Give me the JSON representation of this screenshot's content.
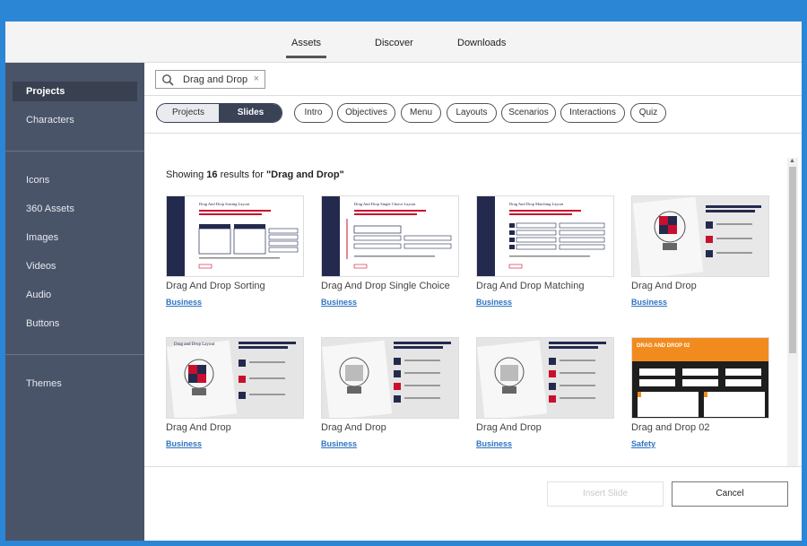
{
  "top_tabs": [
    "Assets",
    "Discover",
    "Downloads"
  ],
  "sidebar": {
    "items": [
      "Projects",
      "Characters",
      "Icons",
      "360 Assets",
      "Images",
      "Videos",
      "Audio",
      "Buttons",
      "Themes"
    ],
    "active": "Projects"
  },
  "search": {
    "query": "Drag and Drop",
    "clear": "×"
  },
  "toggle": {
    "projects": "Projects",
    "slides": "Slides"
  },
  "filters": [
    "Intro",
    "Objectives",
    "Menu",
    "Layouts",
    "Scenarios",
    "Interactions",
    "Quiz"
  ],
  "results": {
    "prefix": "Showing",
    "count": "16",
    "middle": "results for",
    "query": "\"Drag and Drop\""
  },
  "cards": [
    {
      "title": "Drag And Drop Sorting",
      "tag": "Business",
      "thumb_heading": "Drag And Drop Sorting Layout"
    },
    {
      "title": "Drag And Drop Single Choice",
      "tag": "Business",
      "thumb_heading": "Drag And Drop Single Choice Layout"
    },
    {
      "title": "Drag And Drop Matching",
      "tag": "Business",
      "thumb_heading": "Drag And Drop Matching Layout"
    },
    {
      "title": "Drag And Drop",
      "tag": "Business",
      "thumb_heading": ""
    },
    {
      "title": "Drag And Drop",
      "tag": "Business",
      "thumb_heading": "Drag and Drop Layout"
    },
    {
      "title": "Drag And Drop",
      "tag": "Business",
      "thumb_heading": ""
    },
    {
      "title": "Drag And Drop",
      "tag": "Business",
      "thumb_heading": ""
    },
    {
      "title": "Drag and Drop 02",
      "tag": "Safety",
      "thumb_heading": "DRAG AND DROP 02"
    }
  ],
  "footer": {
    "insert": "Insert Slide",
    "cancel": "Cancel"
  },
  "colors": {
    "accent": "#2b86d6",
    "sidebar": "#4a5469",
    "navy": "#232a4e",
    "link": "#2f73c0",
    "orange": "#f28b1e"
  }
}
